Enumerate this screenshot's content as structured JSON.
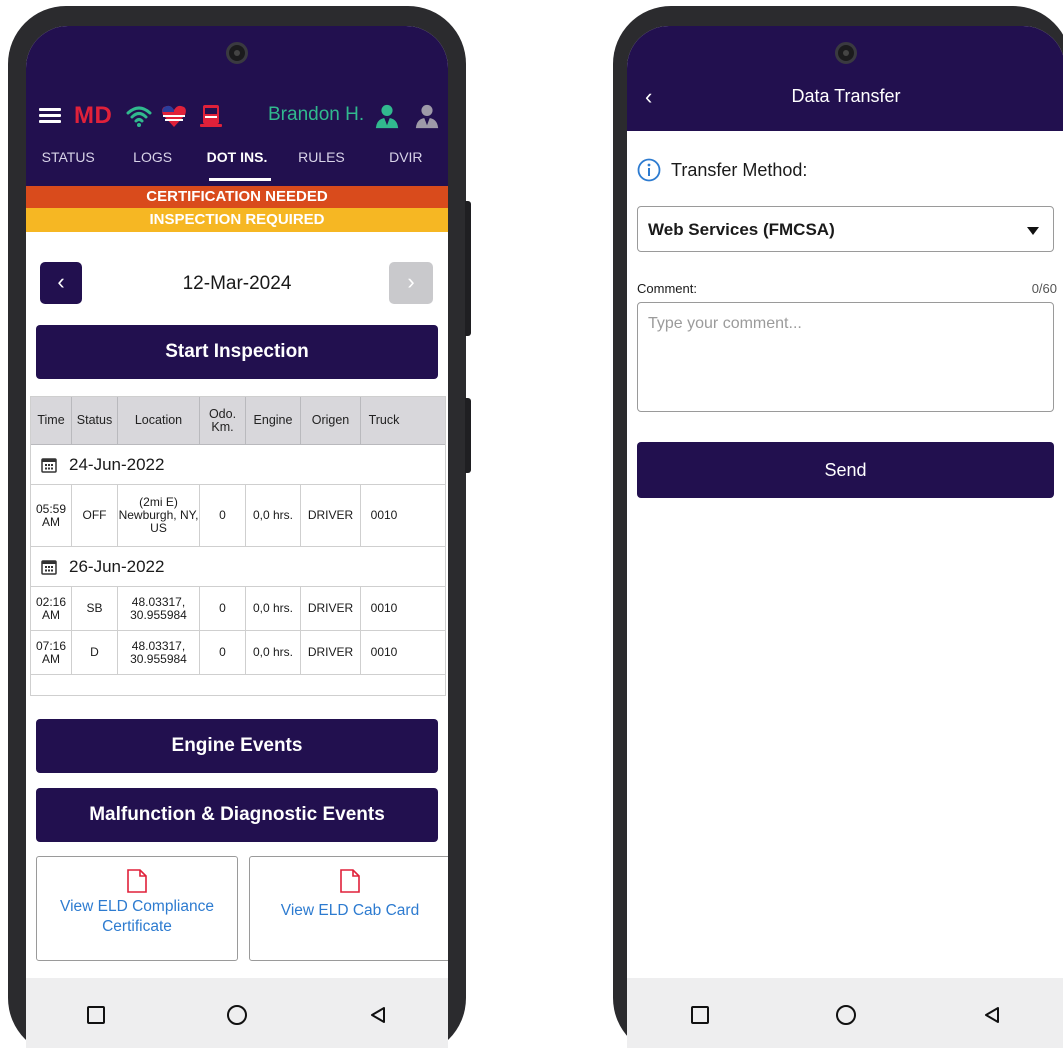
{
  "left_screen": {
    "brand_text": "MD",
    "driver_name": "Brandon H.",
    "tabs": [
      {
        "label": "STATUS"
      },
      {
        "label": "LOGS"
      },
      {
        "label": "DOT INS."
      },
      {
        "label": "RULES"
      },
      {
        "label": "DVIR"
      }
    ],
    "active_tab": "DOT INS.",
    "banners": {
      "certification": "CERTIFICATION NEEDED",
      "inspection": "INSPECTION REQUIRED"
    },
    "date": "12-Mar-2024",
    "start_inspection_label": "Start Inspection",
    "table": {
      "headers": [
        "Time",
        "Status",
        "Location",
        "Odo. Km.",
        "Engine",
        "Origen",
        "Truck"
      ],
      "groups": [
        {
          "date": "24-Jun-2022",
          "rows": [
            {
              "time": "05:59 AM",
              "status": "OFF",
              "location": "(2mi E) Newburgh, NY, US",
              "odo": "0",
              "engine": "0,0 hrs.",
              "origen": "DRIVER",
              "truck": "0010"
            }
          ]
        },
        {
          "date": "26-Jun-2022",
          "rows": [
            {
              "time": "02:16 AM",
              "status": "SB",
              "location": "48.03317, 30.955984",
              "odo": "0",
              "engine": "0,0 hrs.",
              "origen": "DRIVER",
              "truck": "0010"
            },
            {
              "time": "07:16 AM",
              "status": "D",
              "location": "48.03317, 30.955984",
              "odo": "0",
              "engine": "0,0 hrs.",
              "origen": "DRIVER",
              "truck": "0010"
            }
          ]
        }
      ]
    },
    "engine_events_label": "Engine Events",
    "malfunction_label": "Malfunction & Diagnostic Events",
    "compliance_cert_label": "View ELD Compliance Certificate",
    "cab_card_label": "View ELD Cab Card",
    "pdf_icon_text": "PDF"
  },
  "right_screen": {
    "title": "Data Transfer",
    "transfer_method_label": "Transfer Method:",
    "transfer_method_value": "Web Services (FMCSA)",
    "comment_label": "Comment:",
    "comment_count": "0/60",
    "comment_placeholder": "Type your comment...",
    "send_label": "Send"
  },
  "colors": {
    "navy": "#22104f",
    "orange_banner": "#d94b1c",
    "yellow_banner": "#f6b723",
    "link_blue": "#2d7bd0",
    "driver_green": "#31b98e",
    "brand_red": "#e0213a"
  },
  "icons": [
    "menu-icon",
    "wifi-icon",
    "heart-flag-icon",
    "truck-icon",
    "driver-avatar-icon",
    "co-driver-avatar-icon",
    "calendar-icon",
    "pdf-icon",
    "info-icon",
    "chevron-left-icon",
    "chevron-right-icon",
    "dropdown-caret-icon",
    "nav-recents-icon",
    "nav-home-icon",
    "nav-back-icon"
  ]
}
